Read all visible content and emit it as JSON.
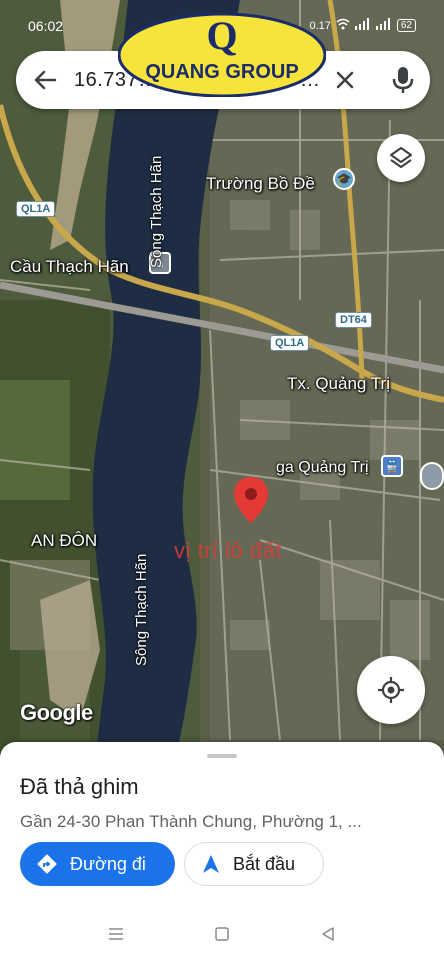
{
  "status_bar": {
    "time": "06:02",
    "speed": "0.17",
    "battery": "62"
  },
  "brand": {
    "logo_text": "QUANG GROUP",
    "logo_letter": "Q"
  },
  "search": {
    "query": "16.737…",
    "query_tail": "…"
  },
  "map": {
    "labels": {
      "school": "Trường Bồ Đề",
      "bridge": "Cầu Thạch Hãn",
      "town": "Tx. Quảng Trị",
      "station": "ga Quảng Trị",
      "village": "AN ĐÔN",
      "river_north": "Sông Thạch Hãn",
      "river_south": "Sông Thạch Hãn"
    },
    "shields": {
      "ql1a_west": "QL1A",
      "ql1a_center": "QL1A",
      "dt64": "DT64"
    },
    "overlay_note": "vị trí lô đất",
    "attribution": "Google"
  },
  "place_sheet": {
    "title": "Đã thả ghim",
    "address": "Gần 24-30 Phan Thành Chung, Phường 1, ...",
    "directions_label": "Đường đi",
    "start_label": "Bắt đầu"
  },
  "colors": {
    "accent": "#1a73e8",
    "pin": "#e53935",
    "road_major": "#c8a84a",
    "river": "#1f2d44"
  },
  "icons": [
    "back-arrow-icon",
    "close-icon",
    "microphone-icon",
    "layers-icon",
    "my-location-icon",
    "directions-icon",
    "navigation-arrow-icon",
    "menu-icon",
    "home-square-icon",
    "back-triangle-icon"
  ]
}
